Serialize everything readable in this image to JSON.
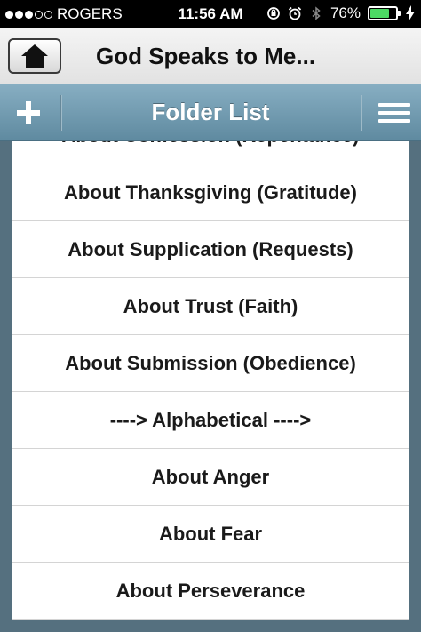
{
  "status_bar": {
    "carrier": "ROGERS",
    "time": "11:56 AM",
    "battery_percent": "76%",
    "battery_level": 0.76,
    "signal_bars_filled": 3,
    "signal_bars_total": 5,
    "icons": [
      "rotation-lock-icon",
      "alarm-icon",
      "bluetooth-icon",
      "battery-icon",
      "charging-bolt-icon"
    ]
  },
  "header": {
    "title": "God Speaks to Me...",
    "home_icon": "home-icon"
  },
  "toolbar": {
    "title": "Folder List",
    "add_icon": "plus-icon",
    "menu_icon": "hamburger-menu-icon",
    "color": "#6f98ad"
  },
  "folders": [
    {
      "label": "About Confession (Repentance)"
    },
    {
      "label": "About Thanksgiving (Gratitude)"
    },
    {
      "label": "About Supplication (Requests)"
    },
    {
      "label": "About Trust (Faith)"
    },
    {
      "label": "About Submission (Obedience)"
    },
    {
      "label": "----> Alphabetical ---->"
    },
    {
      "label": "About Anger"
    },
    {
      "label": "About Fear"
    },
    {
      "label": "About Perseverance"
    }
  ]
}
